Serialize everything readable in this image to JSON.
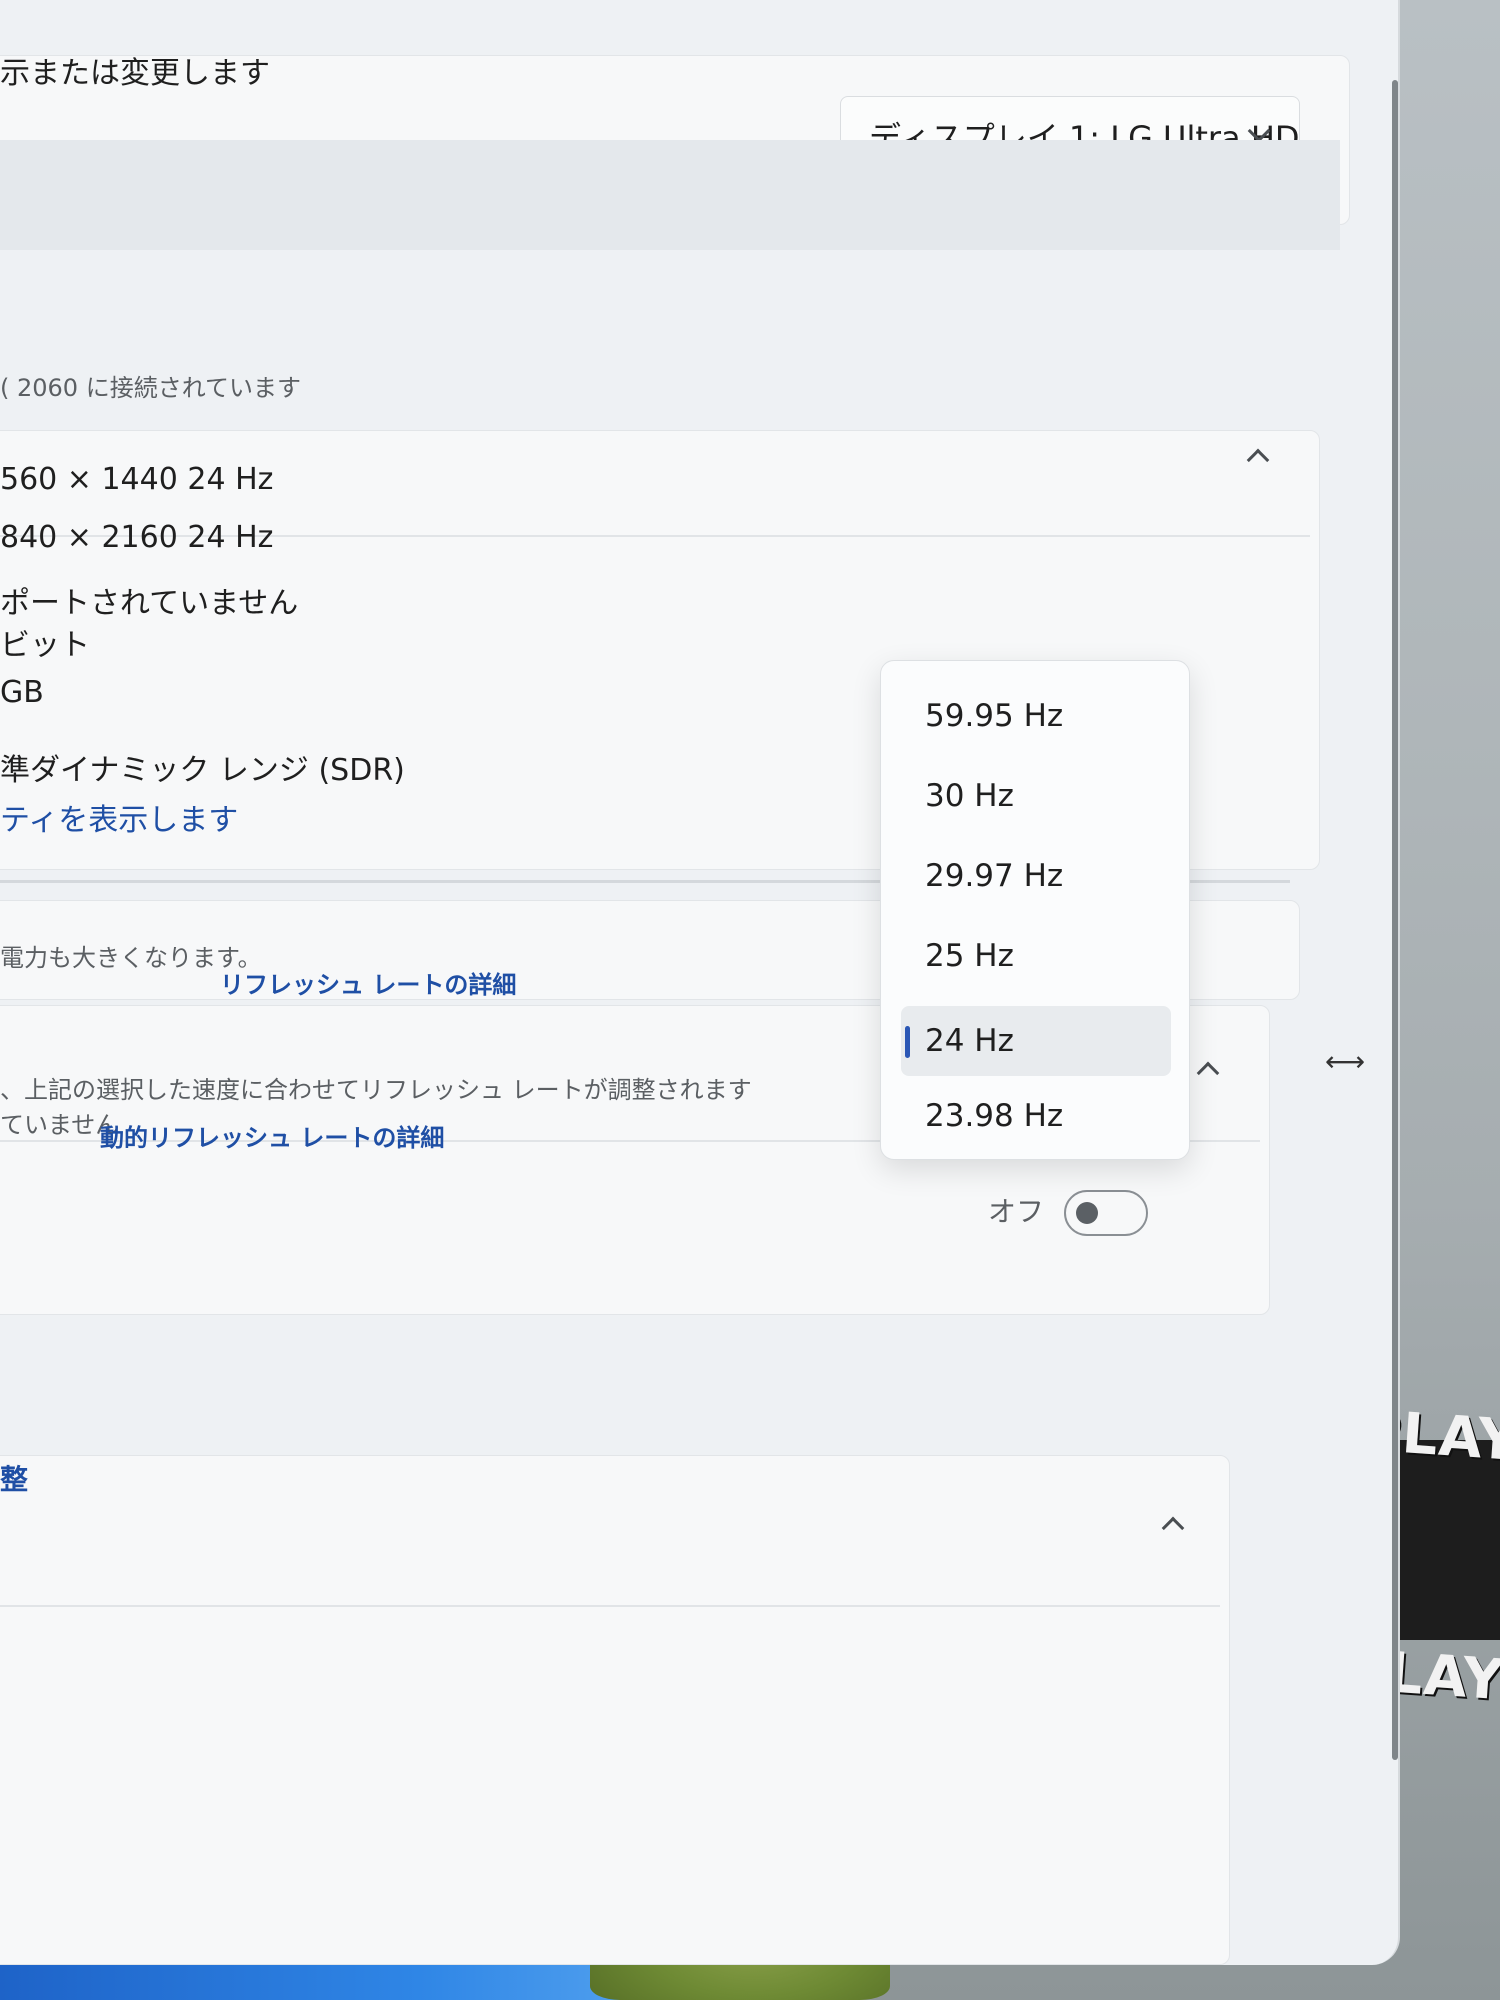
{
  "header": {
    "description": "示または変更します",
    "display_select": {
      "label": "ディスプレイ 1: LG Ultra HD"
    }
  },
  "adapter": {
    "connected_text": "( 2060 に接続されています"
  },
  "advanced_info": {
    "rows": [
      "560 × 1440 24 Hz",
      "840 × 2160 24 Hz",
      "ポートされていません",
      "ビット",
      "GB",
      "準ダイナミック レンジ (SDR)"
    ],
    "properties_link": "ティを表示します"
  },
  "refresh_rate": {
    "description": "電力も大きくなります。",
    "details_link": "リフレッシュ レートの詳細",
    "options": [
      "59.95 Hz",
      "30 Hz",
      "29.97 Hz",
      "25 Hz",
      "24 Hz",
      "23.98 Hz"
    ],
    "selected": "24 Hz"
  },
  "dynamic_refresh": {
    "description": "、上記の選択した速度に合わせてリフレッシュ レートが調整されます",
    "not_supported": "ていません",
    "details_link": "動的リフレッシュ レートの詳細",
    "toggle_label": "オフ",
    "toggle_state": "off"
  },
  "section_bottom": {
    "partial_label": "整"
  },
  "background": {
    "player_labels": [
      "PLAYE",
      "PLAYEI"
    ]
  }
}
